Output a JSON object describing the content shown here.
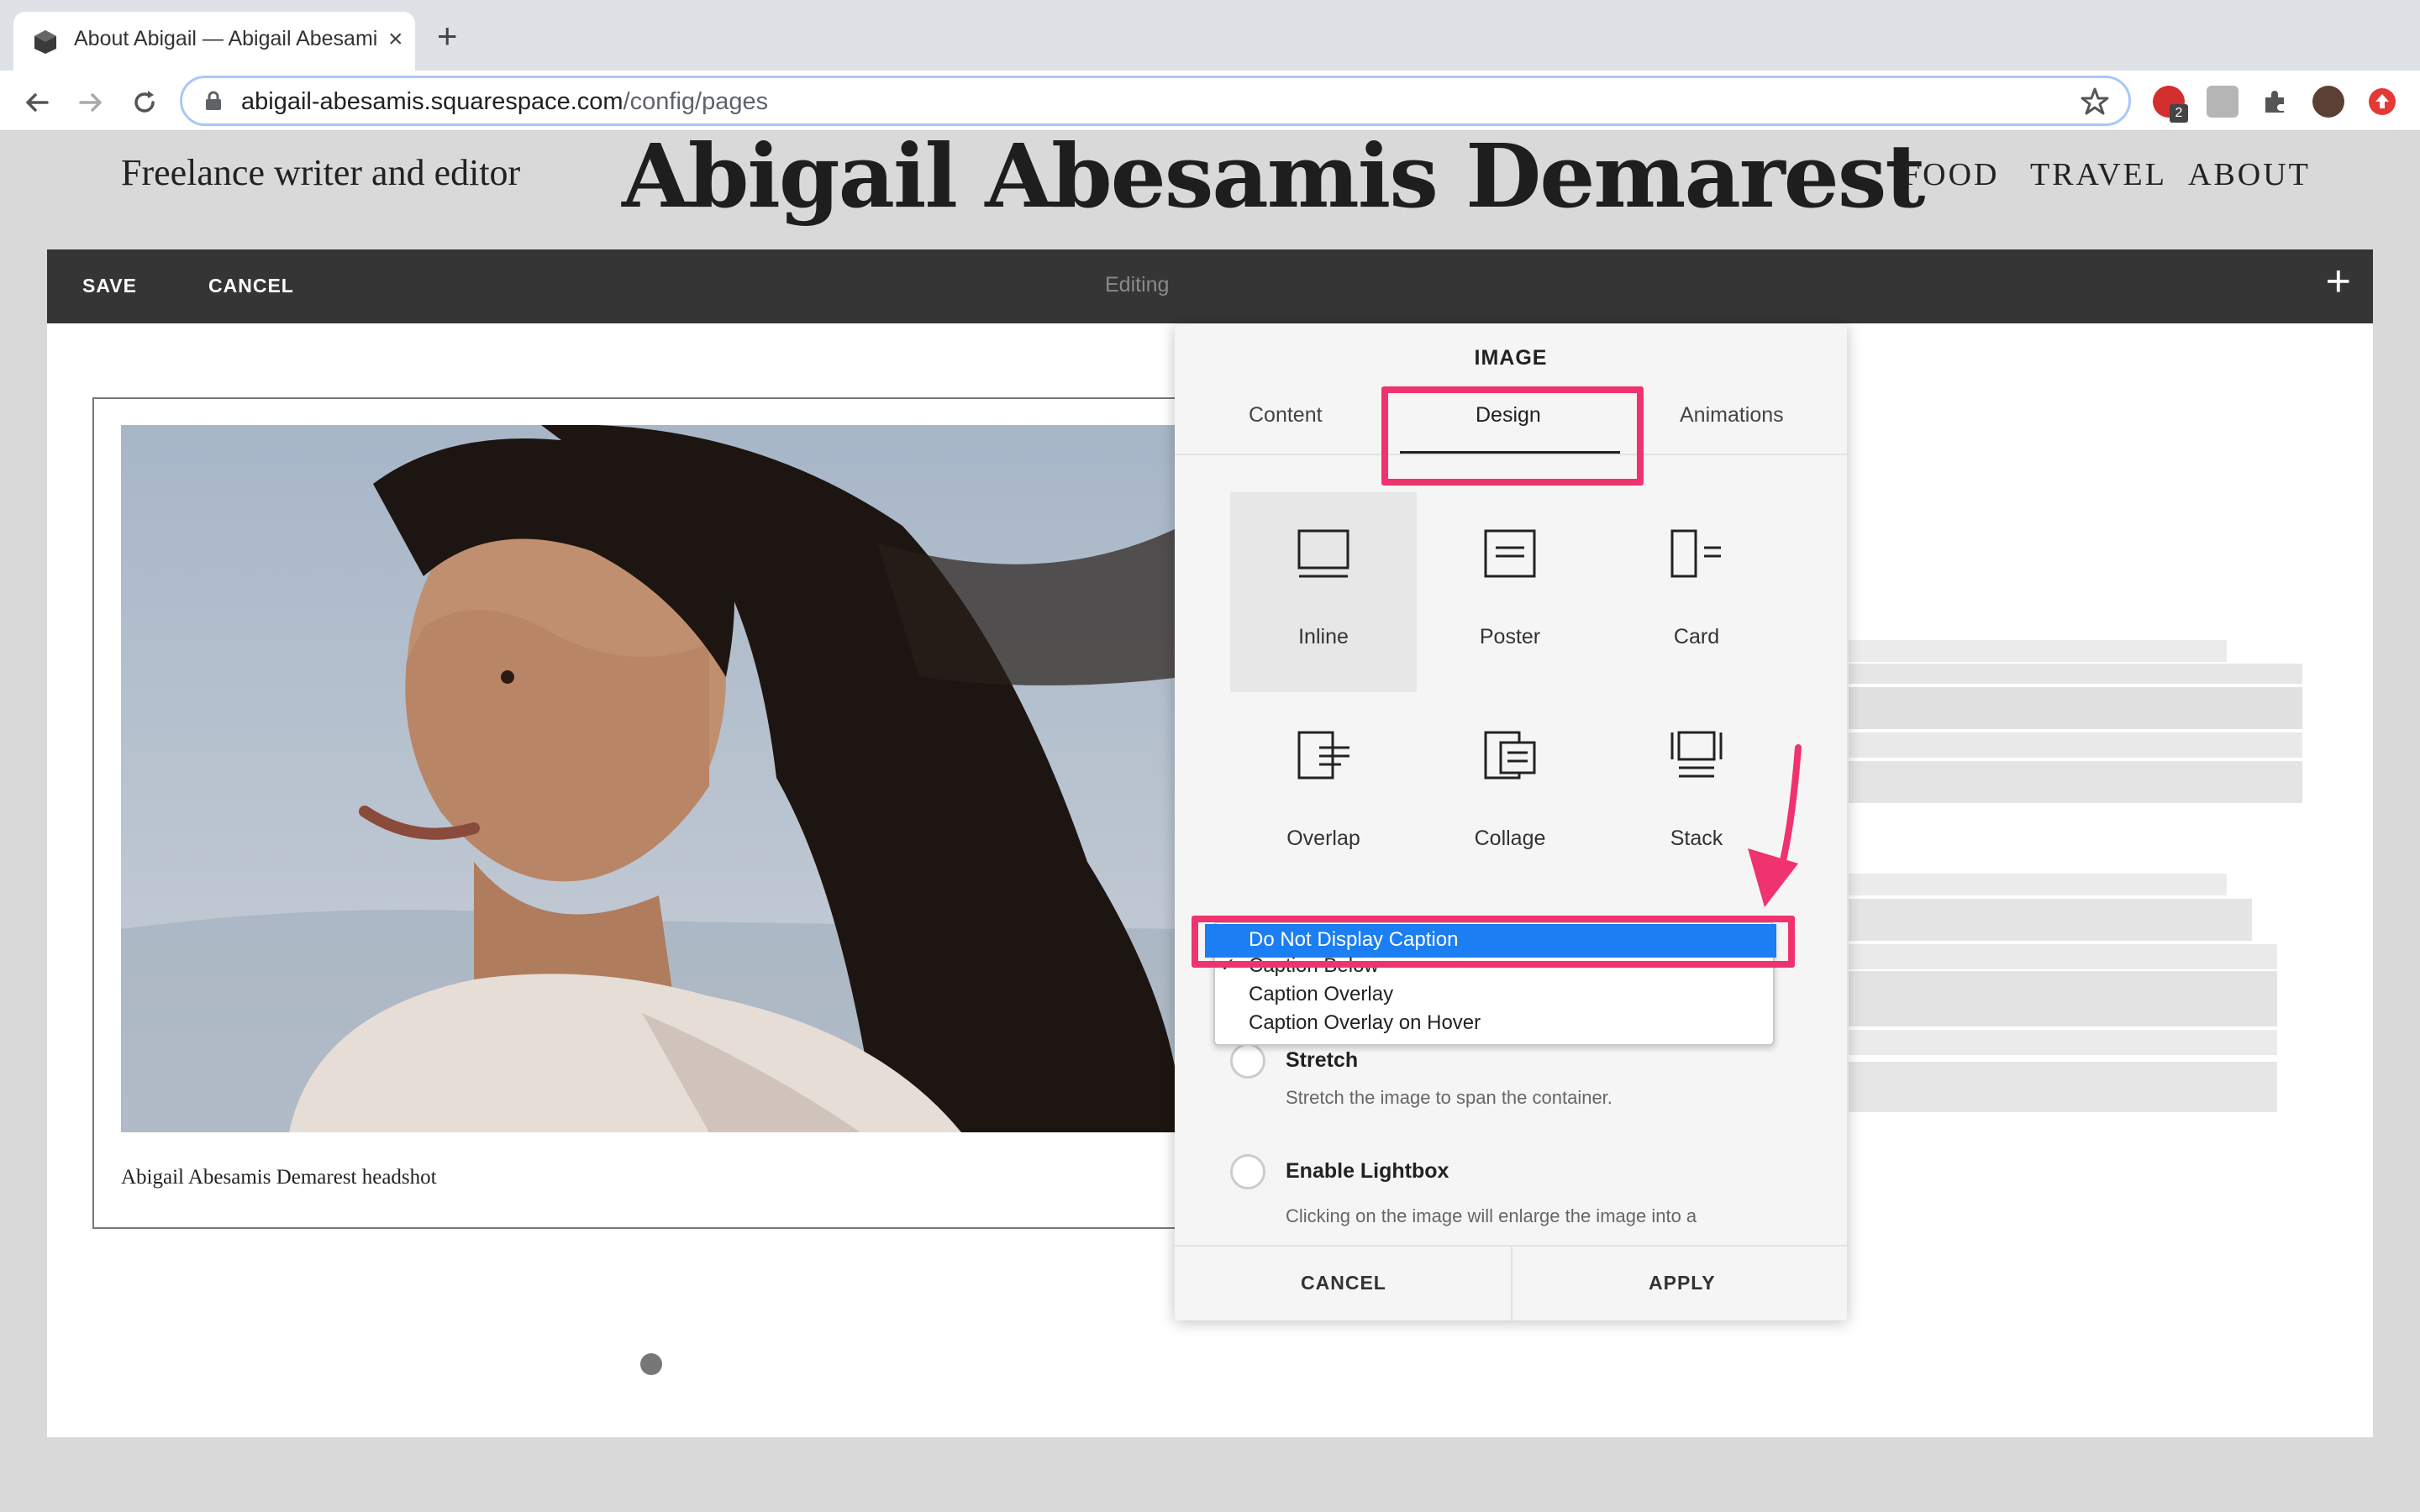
{
  "browser": {
    "tab_title": "About Abigail — Abigail Abesamis Demarest",
    "close_glyph": "×",
    "new_tab_glyph": "+",
    "url_host": "abigail-abesamis.squarespace.com",
    "url_path": "/config/pages",
    "extension_badge": "2"
  },
  "site": {
    "tagline": "Freelance writer and editor",
    "title": "Abigail Abesamis Demarest",
    "nav": [
      "FOOD",
      "TRAVEL",
      "ABOUT"
    ]
  },
  "editor_bar": {
    "save_label": "SAVE",
    "cancel_label": "CANCEL",
    "status": "Editing",
    "add_glyph": "+"
  },
  "image_block": {
    "caption": "Abigail Abesamis Demarest headshot"
  },
  "panel": {
    "title": "IMAGE",
    "tabs": [
      "Content",
      "Design",
      "Animations"
    ],
    "active_tab": "Design",
    "layouts": [
      {
        "label": "Inline",
        "icon": "inline-layout-icon",
        "selected": true
      },
      {
        "label": "Poster",
        "icon": "poster-layout-icon",
        "selected": false
      },
      {
        "label": "Card",
        "icon": "card-layout-icon",
        "selected": false
      },
      {
        "label": "Overlap",
        "icon": "overlap-layout-icon",
        "selected": false
      },
      {
        "label": "Collage",
        "icon": "collage-layout-icon",
        "selected": false
      },
      {
        "label": "Stack",
        "icon": "stack-layout-icon",
        "selected": false
      }
    ],
    "caption_dropdown": {
      "highlighted": "Do Not Display Caption",
      "checked": "Caption Below",
      "check_glyph": "✓",
      "options": [
        "Do Not Display Caption",
        "Caption Below",
        "Caption Overlay",
        "Caption Overlay on Hover"
      ]
    },
    "stretch": {
      "label": "Stretch",
      "description": "Stretch the image to span the container."
    },
    "lightbox": {
      "label": "Enable Lightbox",
      "description": "Clicking on the image will enlarge the image into a lightbox."
    },
    "cancel_label": "CANCEL",
    "apply_label": "APPLY"
  },
  "colors": {
    "annotation": "#f0326e",
    "dropdown_highlight": "#1b7ef2",
    "editor_bar": "#353535"
  }
}
